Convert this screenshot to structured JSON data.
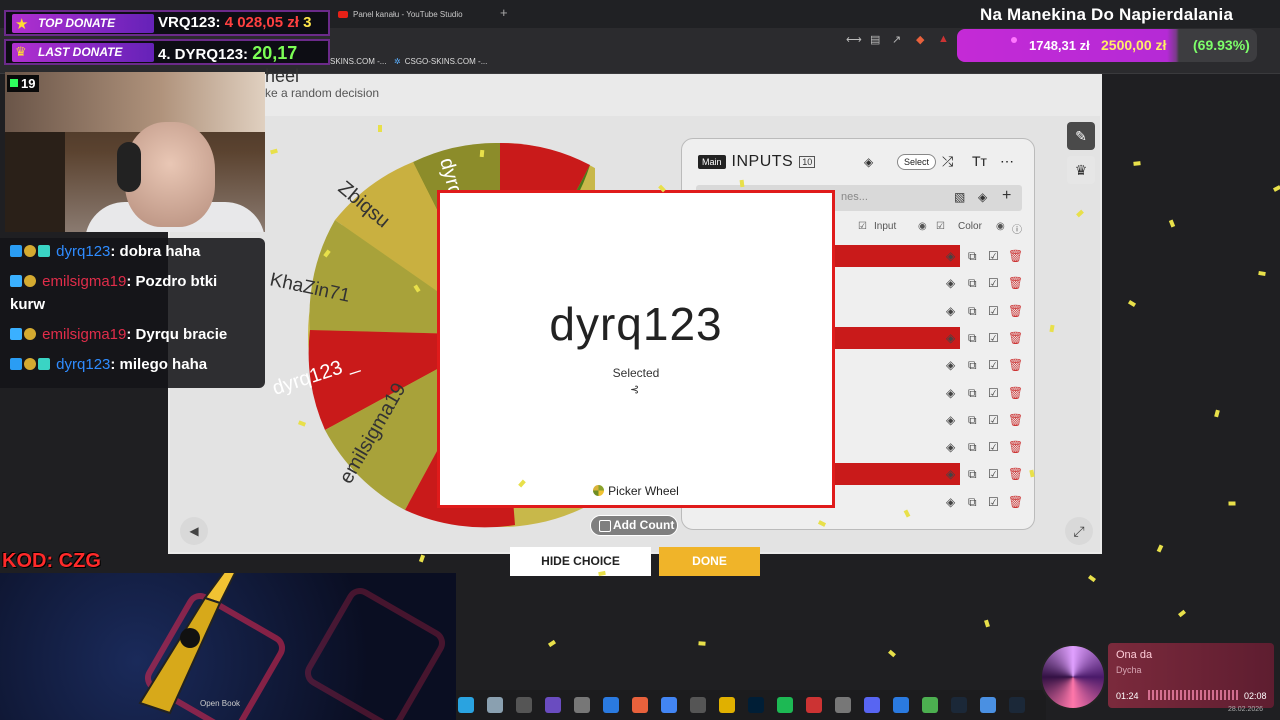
{
  "browser": {
    "tab_title": "Panel kanału - YouTube Studio",
    "new_tab_glyph": "+",
    "bookmarks": [
      "SKINS.COM -...",
      "CSGO-SKINS.COM -..."
    ]
  },
  "stream": {
    "title": "Na Manekina Do Napierdalania",
    "code_label": "KOD: CZG",
    "viewer_count": "19"
  },
  "goal": {
    "current": "1748,31 zł",
    "target": "2500,00 zł",
    "percent": "(69.93%)"
  },
  "donations": {
    "top_label": "TOP DONATE",
    "top_name": "VRQ123:",
    "top_amount": "4 028,05 zł",
    "top_extra": "3",
    "last_label": "LAST DONATE",
    "last_text": "4. DYRQ123:",
    "last_amount": "20,17"
  },
  "chat": [
    {
      "user": "dyrq123",
      "text": ": dobra haha",
      "color": "blue"
    },
    {
      "user": "emilsigma19",
      "text": ": Pozdro btki",
      "text2": "kurw",
      "color": "red"
    },
    {
      "user": "emilsigma19",
      "text": ": Dyrqu bracie",
      "color": "red"
    },
    {
      "user": "dyrq123",
      "text": ": milego haha",
      "color": "blue"
    }
  ],
  "page": {
    "title": "heel",
    "subtitle": "ke a random decision"
  },
  "wheel": {
    "slices": [
      "dyrq",
      "Zbiqsu",
      "KhaZin71",
      "dyrq123 _",
      "emilsigma19"
    ]
  },
  "inputs_panel": {
    "main_tag": "Main",
    "label": "INPUTS",
    "count": "10",
    "select_label": "Select",
    "search_placeholder": "nes...",
    "col_input": "Input",
    "col_color": "Color"
  },
  "result": {
    "name": "dyrq123",
    "selected_label": "Selected",
    "brand": "Picker Wheel",
    "add_count": "Add Count",
    "hide_choice": "HIDE CHOICE",
    "done": "DONE"
  },
  "music": {
    "title": "Ona da",
    "artist": "Dycha",
    "elapsed": "01:24",
    "total": "02:08",
    "date": "28.02.2026"
  },
  "ad": {
    "label1": "Open Book",
    "label2": ""
  },
  "colors": {
    "accent_red": "#e01b1b",
    "done_yellow": "#f0b429",
    "goal_magenta": "#c42ad6"
  }
}
